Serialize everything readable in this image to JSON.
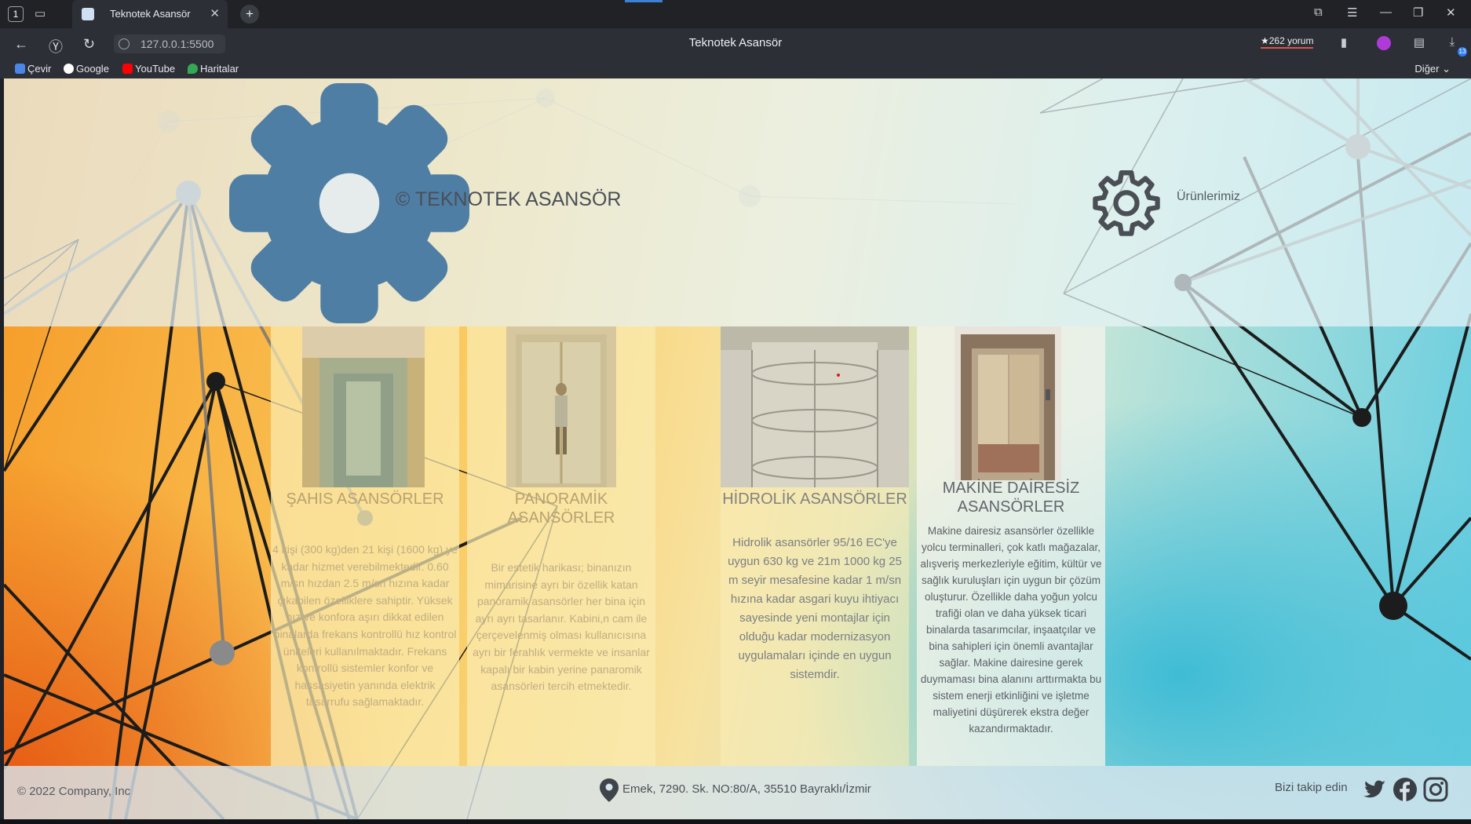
{
  "browser": {
    "tab_count": "1",
    "active_tab_title": "Teknotek Asansör",
    "url": "127.0.0.1:5500",
    "page_title": "Teknotek Asansör",
    "reviews": "★262 yorum",
    "download_count": "13",
    "bookmarks": [
      {
        "label": "Çevir",
        "icon": "translate-icon",
        "color": "#4a86e8"
      },
      {
        "label": "Google",
        "icon": "google-icon",
        "color": "#ffffff"
      },
      {
        "label": "YouTube",
        "icon": "youtube-icon",
        "color": "#ff0000"
      },
      {
        "label": "Haritalar",
        "icon": "maps-icon",
        "color": "#34a853"
      }
    ],
    "bookmarks_more": "Diğer ⌄"
  },
  "header": {
    "brand": "© TEKNOTEK ASANSÖR",
    "nav_link": "Ürünlerimiz",
    "brand_gear_color": "#4f7ea4",
    "nav_gear_color": "#4a4f56"
  },
  "cards": [
    {
      "title": "ŞAHIS ASANSÖRLER",
      "text": "4 kişi (300 kg)den 21 kişi (1600 kg) ye kadar hizmet verebilmektedir. 0.60 m/sn hızdan 2.5 m/sn hızına kadar çıkabilen özelliklere sahiptir. Yüksek hız ve konfora aşırı dikkat edilen binalarda frekans kontrollü hız kontrol üniteleri kullanılmaktadır. Frekans kontrollü sistemler konfor ve hassasiyetin yanında elektrik tasarrufu sağlamaktadır."
    },
    {
      "title": "PANORAMİK ASANSÖRLER",
      "text": "Bir estetik harikası; binanızın mimarisine ayrı bir özellik katan panoramik asansörler her bina için ayrı ayrı tasarlanır. Kabini,n cam ile çerçevelenmiş olması kullanıcısına ayrı bir ferahlık vermekte ve insanlar kapalı bir kabin yerine panaromik asansörleri tercih etmektedir."
    },
    {
      "title": "HİDROLİK ASANSÖRLER",
      "text": "Hidrolik asansörler 95/16 EC'ye uygun 630 kg ve 21m 1000 kg 25 m seyir mesafesine kadar 1 m/sn hızına kadar asgari kuyu ihtiyacı sayesinde yeni montajlar için olduğu kadar modernizasyon uygulamaları içinde en uygun sistemdir."
    },
    {
      "title": "MAKİNE DAİRESİZ ASANSÖRLER",
      "text": "Makine dairesiz asansörler özellikle yolcu terminalleri, çok katlı mağazalar, alışveriş merkezleriyle eğitim, kültür ve sağlık kuruluşları için uygun bir çözüm oluşturur. Özellikle daha yoğun yolcu trafiği olan ve daha yüksek ticari binalarda tasarımcılar, inşaatçılar ve bina sahipleri için önemli avantajlar sağlar. Makine dairesine gerek duymaması bina alanını arttırmakta bu sistem enerji etkinliğini ve işletme maliyetini düşürerek ekstra değer kazandırmaktadır."
    }
  ],
  "footer": {
    "copyright": "© 2022 Company, Inc",
    "address": "Emek, 7290. Sk. NO:80/A, 35510 Bayraklı/İzmir",
    "follow": "Bizi takip edin",
    "social": [
      "twitter-icon",
      "facebook-icon",
      "instagram-icon"
    ]
  }
}
